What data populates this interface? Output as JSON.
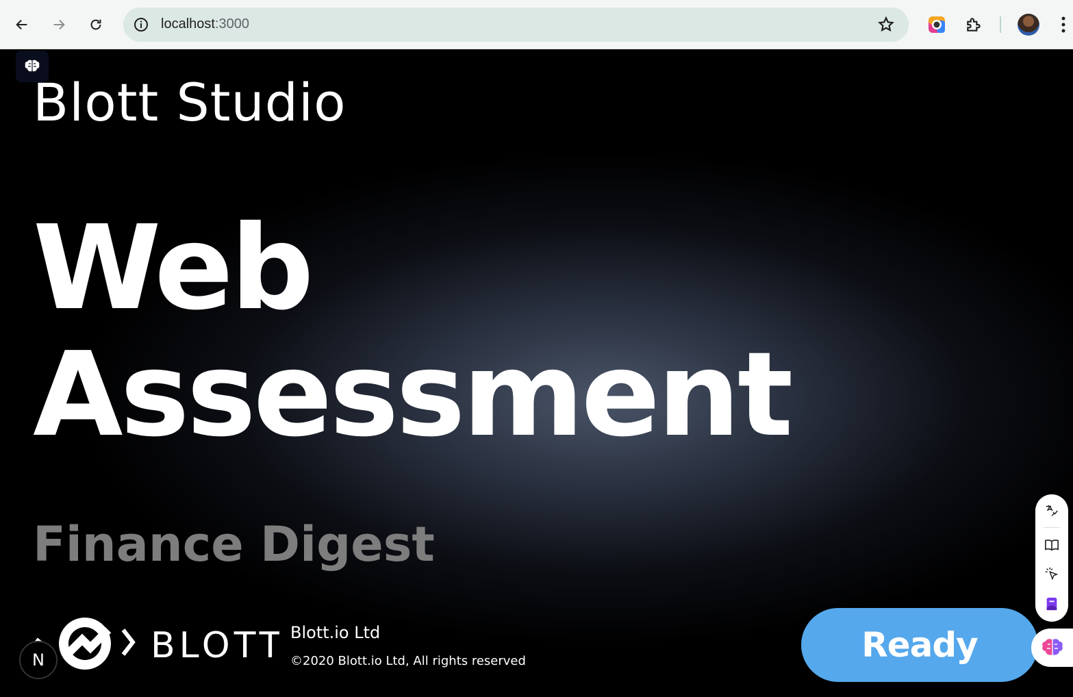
{
  "browser": {
    "url_host": "localhost",
    "url_port": ":3000"
  },
  "page": {
    "studio_title": "Blott Studio",
    "hero_line1": "Web",
    "hero_line2": "Assessment",
    "subtitle": "Finance Digest",
    "footer": {
      "logo_text": "BLOTT",
      "company": "Blott.io Ltd",
      "copyright": "©2020 Blott.io Ltd, All rights reserved"
    },
    "ready_label": "Ready",
    "next_badge": "N"
  },
  "colors": {
    "accent": "#55a8ec",
    "subtitle": "#7d7d7d",
    "omnibox": "#dbe8e4"
  }
}
